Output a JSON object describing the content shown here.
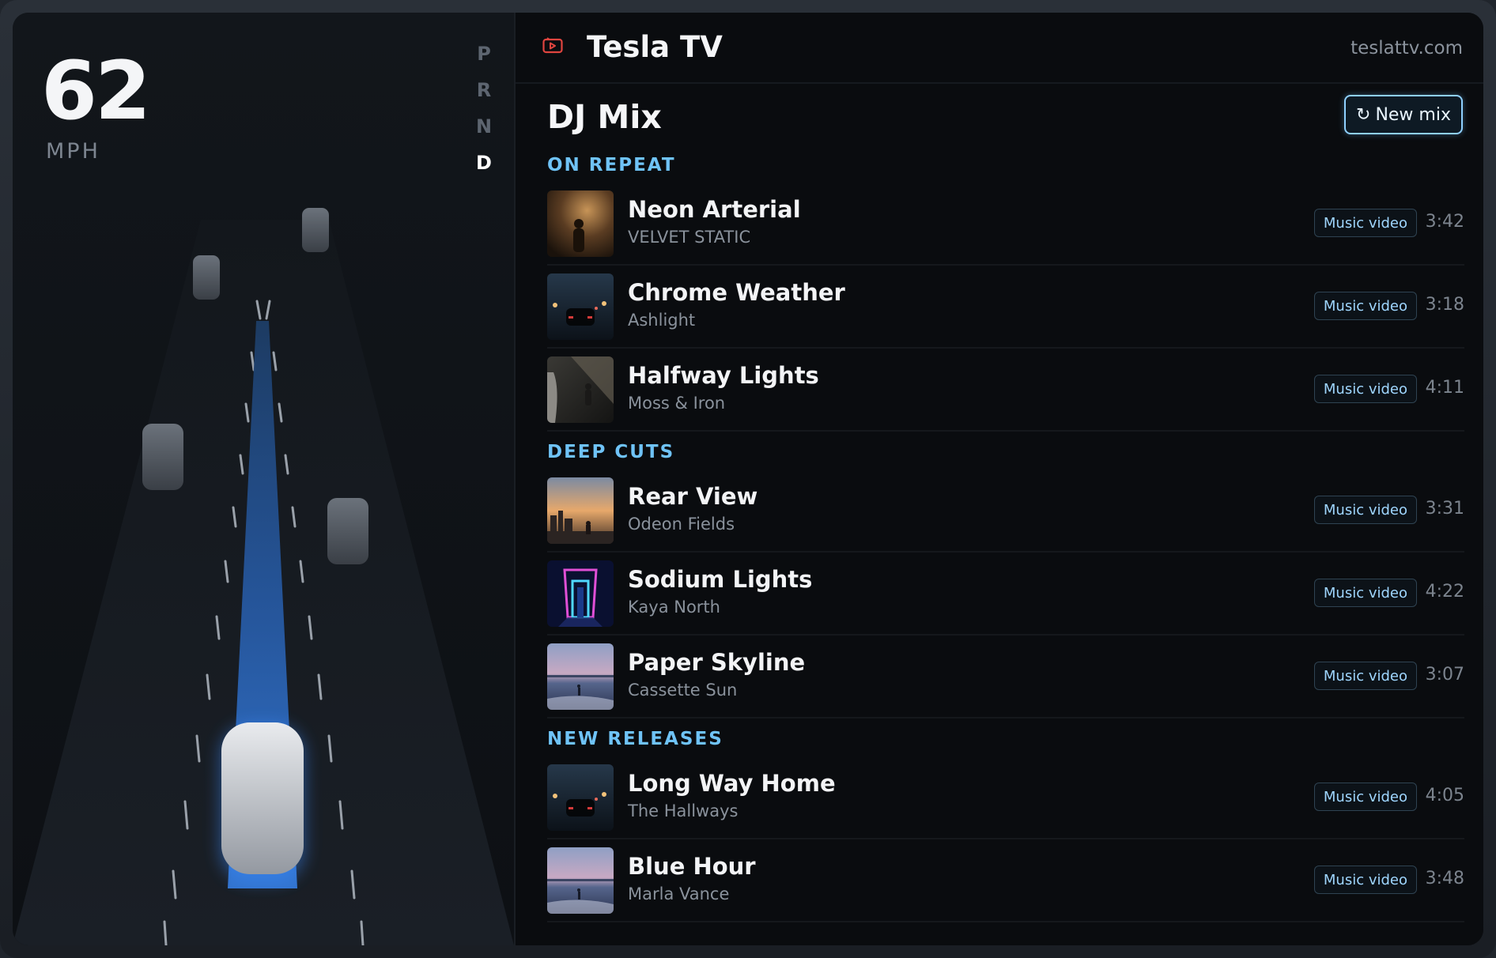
{
  "dashboard": {
    "speed": "62",
    "speed_unit": "MPH",
    "gears": [
      "P",
      "R",
      "N",
      "D"
    ],
    "active_gear": "D"
  },
  "header": {
    "logo_icon": "play-screen-icon",
    "app_title": "Tesla TV",
    "site_url": "teslattv.com"
  },
  "mix": {
    "title": "DJ Mix",
    "new_mix_icon": "refresh-icon",
    "new_mix_label": "New mix"
  },
  "sections": [
    {
      "label": "ON REPEAT",
      "tracks": [
        {
          "title": "Neon Arterial",
          "artist": "VELVET STATIC",
          "badge": "Music video",
          "duration": "3:42",
          "thumb": "concert-silhouette"
        },
        {
          "title": "Chrome Weather",
          "artist": "Ashlight",
          "badge": "Music video",
          "duration": "3:18",
          "thumb": "car-night-street"
        },
        {
          "title": "Halfway Lights",
          "artist": "Moss & Iron",
          "badge": "Music video",
          "duration": "4:11",
          "thumb": "dancer-window-light"
        }
      ]
    },
    {
      "label": "DEEP CUTS",
      "tracks": [
        {
          "title": "Rear View",
          "artist": "Odeon Fields",
          "badge": "Music video",
          "duration": "3:31",
          "thumb": "city-sunset"
        },
        {
          "title": "Sodium Lights",
          "artist": "Kaya North",
          "badge": "Music video",
          "duration": "4:22",
          "thumb": "neon-doorway"
        },
        {
          "title": "Paper Skyline",
          "artist": "Cassette Sun",
          "badge": "Music video",
          "duration": "3:07",
          "thumb": "beach-dusk"
        }
      ]
    },
    {
      "label": "NEW RELEASES",
      "tracks": [
        {
          "title": "Long Way Home",
          "artist": "The Hallways",
          "badge": "Music video",
          "duration": "4:05",
          "thumb": "car-night-street"
        },
        {
          "title": "Blue Hour",
          "artist": "Marla Vance",
          "badge": "Music video",
          "duration": "3:48",
          "thumb": "beach-dusk"
        }
      ]
    }
  ],
  "colors": {
    "accent": "#6fc3f7",
    "path_blue": "#2f6fce",
    "logo_red": "#e0453f",
    "background": "#0a0c0f"
  }
}
